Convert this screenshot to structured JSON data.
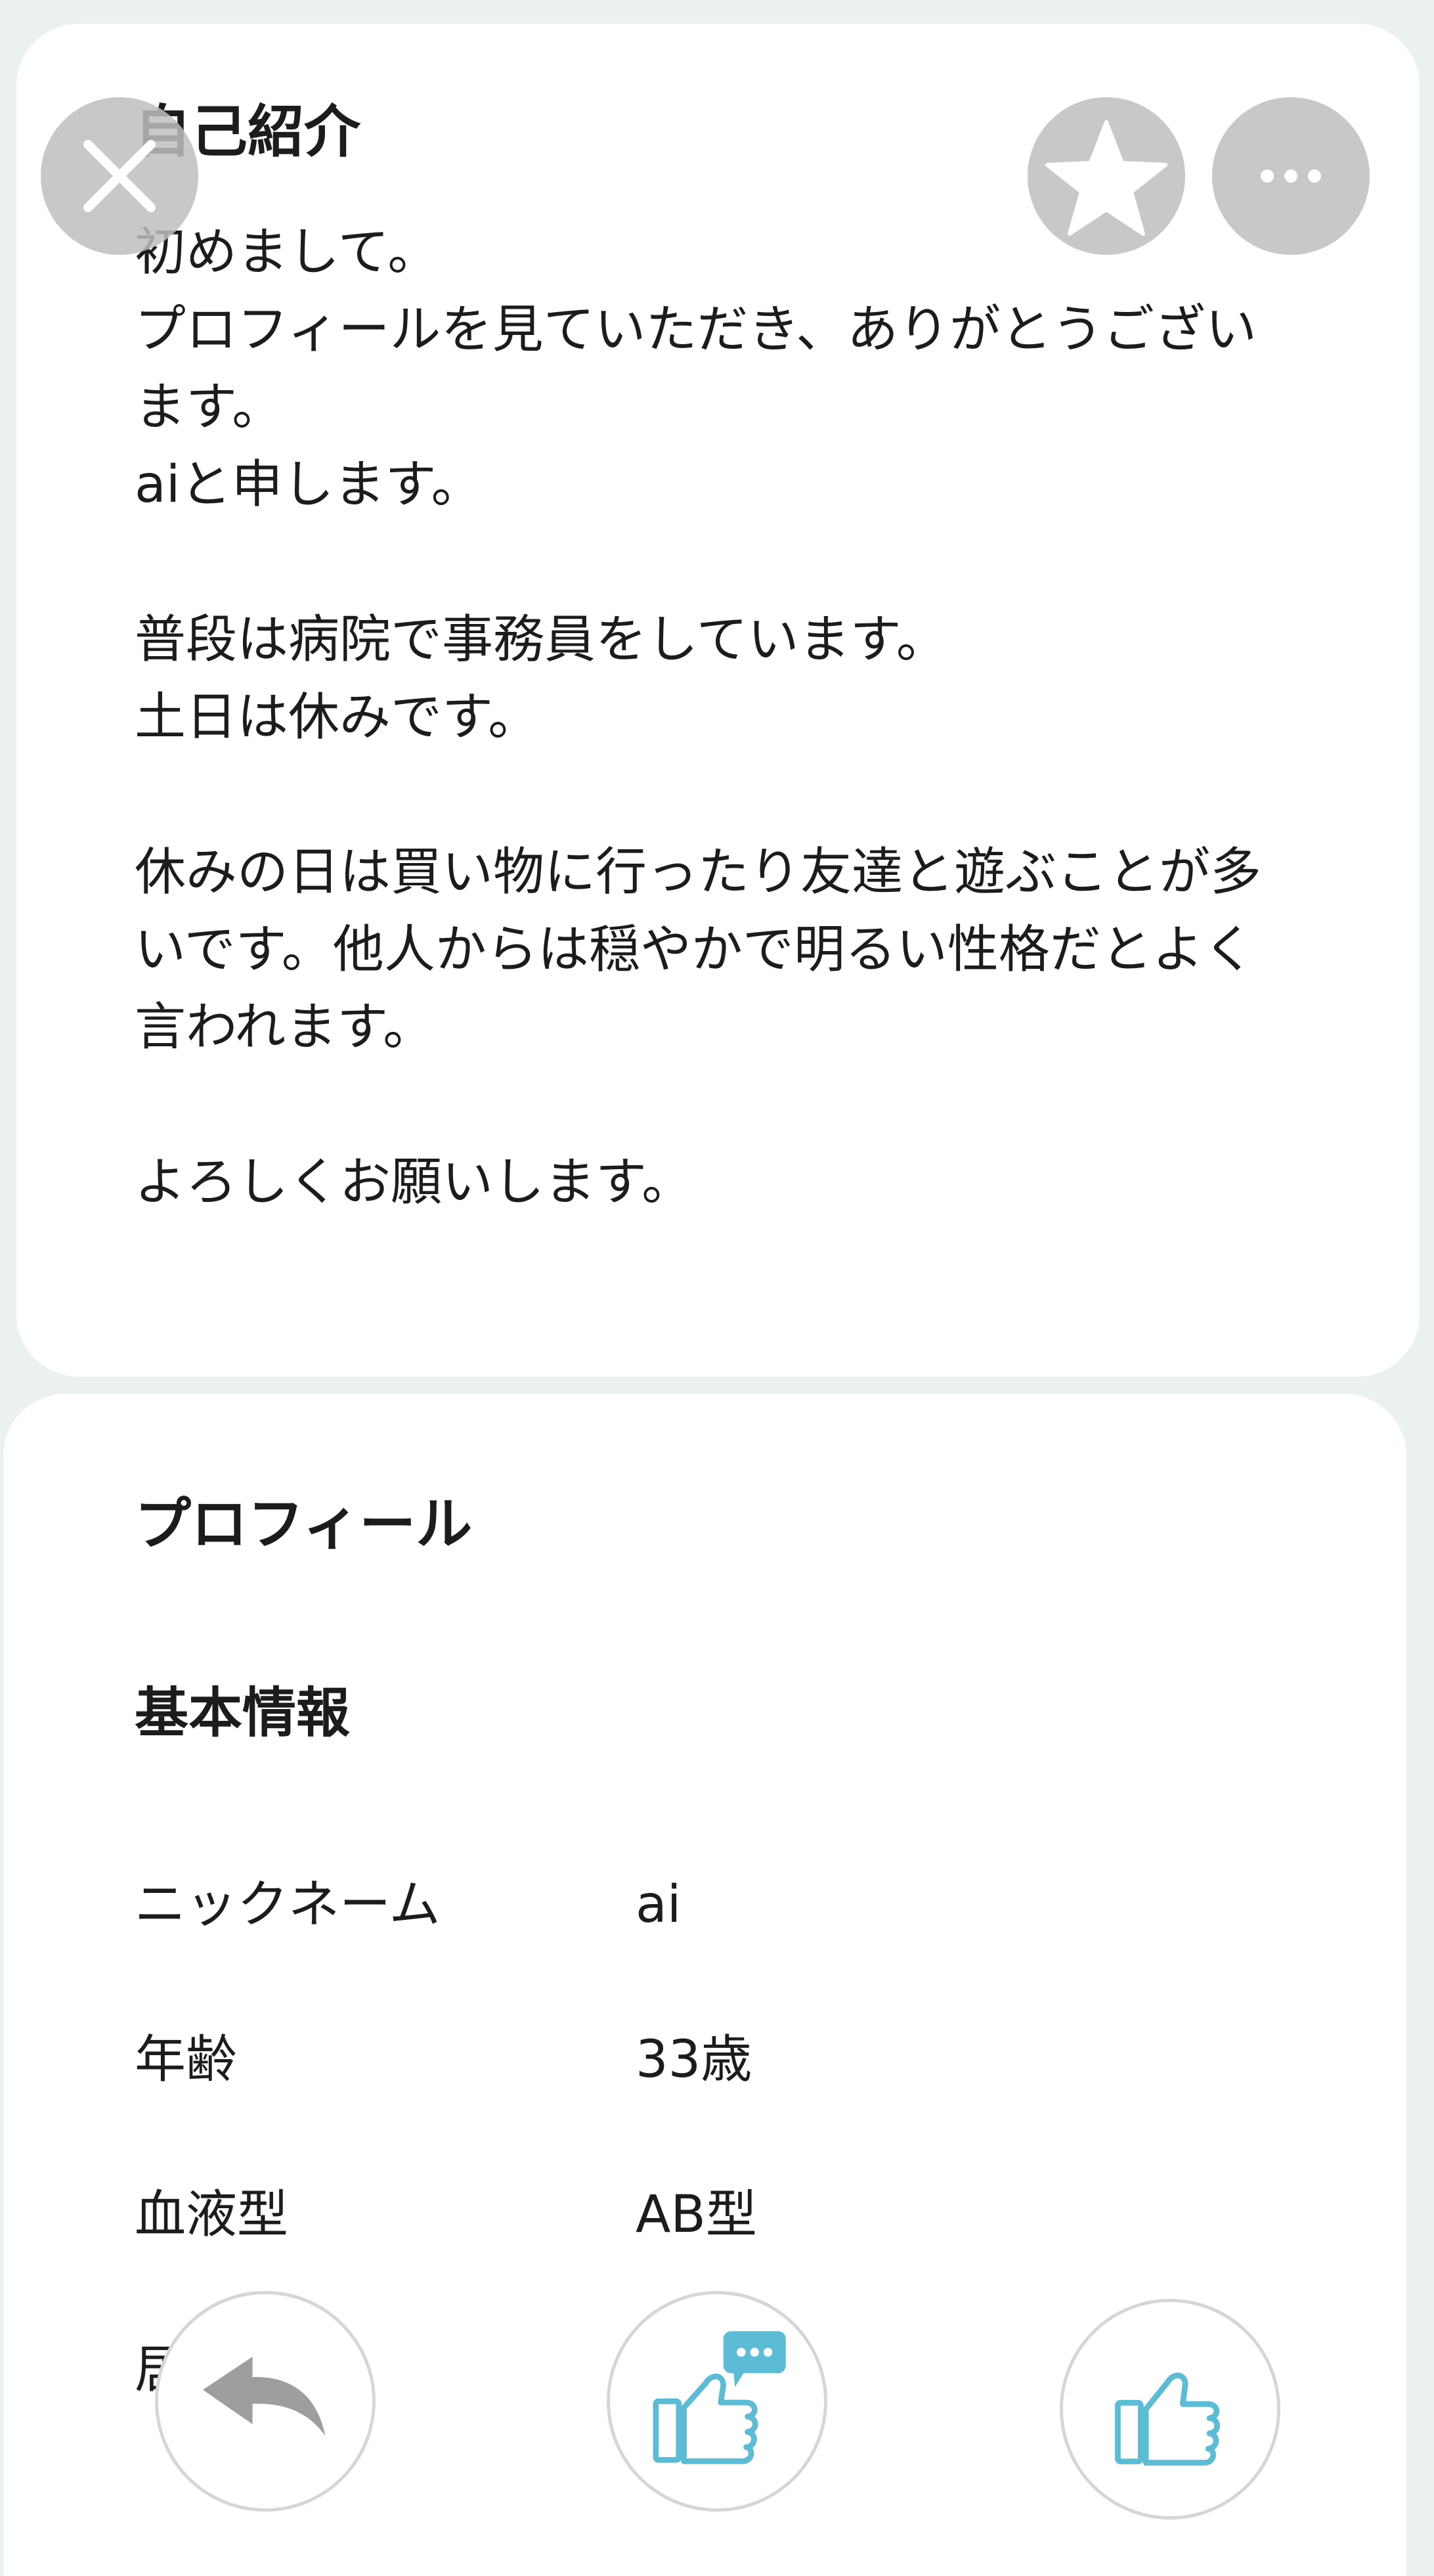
{
  "intro": {
    "title": "自己紹介",
    "body": "初めまして。\nプロフィールを見ていただき、ありがとうございます。\naiと申します。\n\n普段は病院で事務員をしています。\n土日は休みです。\n\n休みの日は買い物に行ったり友達と遊ぶことが多いです。他人からは穏やかで明るい性格だとよく言われます。\n\nよろしくお願いします。"
  },
  "profile": {
    "title": "プロフィール",
    "basic_title": "基本情報",
    "rows": [
      {
        "label": "ニックネーム",
        "value": "ai"
      },
      {
        "label": "年齢",
        "value": "33歳"
      },
      {
        "label": "血液型",
        "value": "AB型"
      },
      {
        "label": "居",
        "value": ""
      }
    ]
  },
  "icons": {
    "close": "close-icon",
    "favorite": "star-icon",
    "more": "more-dots-icon",
    "back": "undo-arrow-icon",
    "like_with_message": "thumbs-up-message-icon",
    "like": "thumbs-up-icon"
  },
  "colors": {
    "background": "#ebf1f1",
    "card": "#ffffff",
    "text": "#1c1c1c",
    "overlay_button": "#c8c8c8",
    "accent": "#5cbcd6",
    "back_arrow": "#9e9e9e",
    "action_border": "#d6d6d6"
  }
}
